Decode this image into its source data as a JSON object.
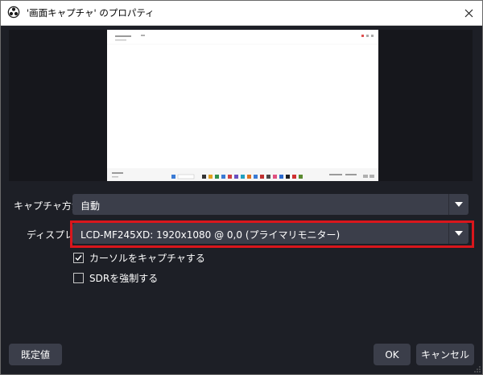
{
  "window": {
    "title": "'画面キャプチャ' のプロパティ"
  },
  "form": {
    "capture_method": {
      "label": "キャプチャ方法",
      "value": "自動"
    },
    "display": {
      "label": "ディスプレイ",
      "value": "LCD-MF245XD: 1920x1080 @ 0,0 (プライマリモニター)"
    },
    "capture_cursor": {
      "label": "カーソルをキャプチャする",
      "checked": true
    },
    "force_sdr": {
      "label": "SDRを強制する",
      "checked": false
    }
  },
  "buttons": {
    "defaults": "既定値",
    "ok": "OK",
    "cancel": "キャンセル"
  },
  "colors": {
    "dialog_bg": "#1d1f26",
    "control_bg": "#3b3e4a",
    "highlight": "#d9161c"
  }
}
